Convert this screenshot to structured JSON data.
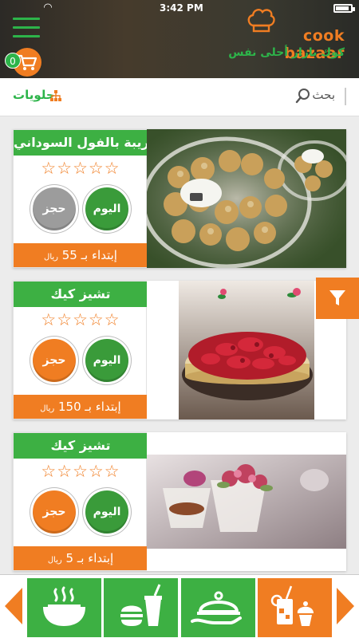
{
  "status": {
    "time": "3:42 PM"
  },
  "header": {
    "cart_count": "0",
    "brand": "cook bazaar",
    "tagline": "كوك بازار أحلى نفس"
  },
  "search": {
    "label": "بحث",
    "category": "حلويات"
  },
  "products": [
    {
      "title": "غريبة بالفول السوداني",
      "today_label": "اليوم",
      "book_label": "حجز",
      "price_prefix": "إبتداء بـ",
      "price": "55",
      "currency": "ريال",
      "book_enabled": false,
      "image_name": "sesame-cookies-photo"
    },
    {
      "title": "تشيز كيك",
      "today_label": "اليوم",
      "book_label": "حجز",
      "price_prefix": "إبتداء بـ",
      "price": "150",
      "currency": "ريال",
      "book_enabled": true,
      "image_name": "rose-cheesecake-photo"
    },
    {
      "title": "تشيز كيك",
      "today_label": "اليوم",
      "book_label": "حجز",
      "price_prefix": "إبتداء بـ",
      "price": "5",
      "currency": "ريال",
      "book_enabled": true,
      "image_name": "cheesecake-cups-photo"
    }
  ],
  "colors": {
    "green": "#3db043",
    "orange": "#f07d22",
    "grey": "#9c9c9c"
  },
  "bottom_nav": [
    {
      "icon": "arrow-left-icon"
    },
    {
      "icon": "soup-bowl-icon"
    },
    {
      "icon": "fast-food-icon"
    },
    {
      "icon": "serving-dish-icon"
    },
    {
      "icon": "drinks-desserts-icon"
    },
    {
      "icon": "arrow-right-icon"
    }
  ]
}
